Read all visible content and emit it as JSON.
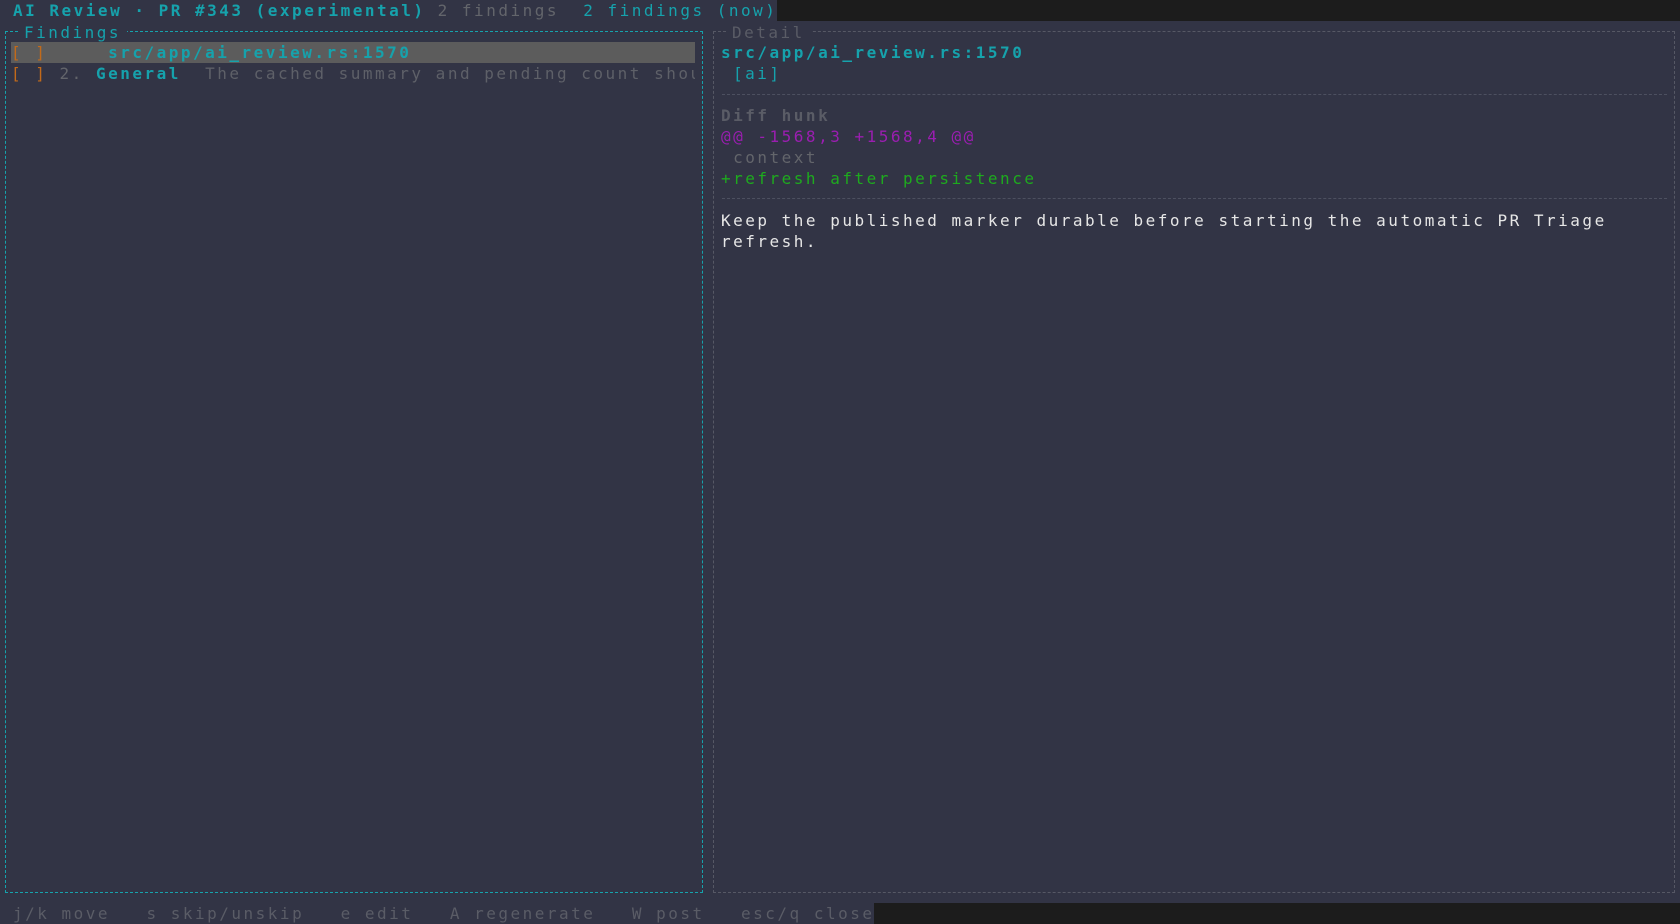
{
  "header": {
    "title": "AI Review · PR #343 (experimental)",
    "count_a": "2 findings",
    "count_b": "2 findings (now)"
  },
  "findings": {
    "panel_title": "Findings",
    "items": [
      {
        "checkbox": "[ ]",
        "number": "",
        "location": "src/app/ai_review.rs:1570",
        "summary": ""
      },
      {
        "checkbox": "[ ]",
        "number": "2.",
        "location": "General",
        "summary": "The cached summary and pending count shou"
      }
    ]
  },
  "detail": {
    "panel_title": "Detail",
    "location": "src/app/ai_review.rs:1570",
    "tag": "[ai]",
    "diff_label": "Diff hunk",
    "hunk_range": "@@ -1568,3 +1568,4 @@",
    "context_line": " context",
    "added_line": "+refresh after persistence",
    "message_line1": "Keep the published marker durable before starting the automatic PR Triage",
    "message_line2": "refresh."
  },
  "footer": {
    "move": "j/k move",
    "skip": "s skip/unskip",
    "edit": "e edit",
    "regenerate": "A regenerate",
    "post": "W post",
    "close": "esc/q close"
  },
  "colors": {
    "accent": "#16a2ac",
    "added": "#1eaa1e",
    "hunk": "#9a1eb0",
    "checkbox": "#c26a1a",
    "background": "#323445"
  }
}
